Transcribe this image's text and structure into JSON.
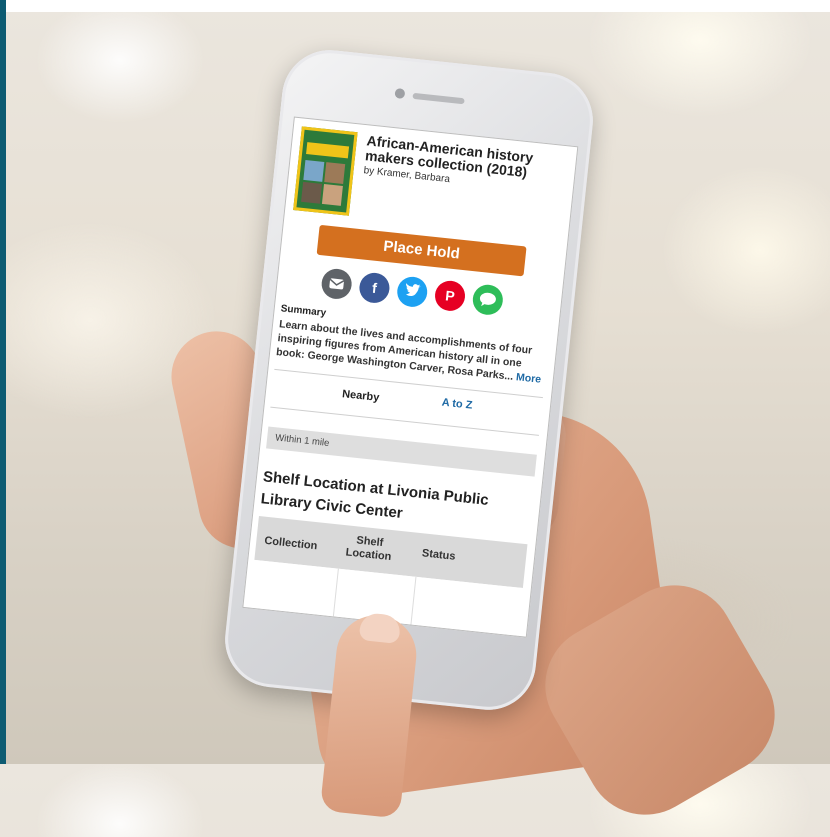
{
  "colors": {
    "accent_bar": "#0d5b72",
    "place_hold": "#d4701f",
    "link": "#1f6aa5"
  },
  "book": {
    "title": "African-American history makers collection (2018)",
    "author": "by Kramer, Barbara"
  },
  "actions": {
    "place_hold_label": "Place Hold"
  },
  "share": {
    "icons": [
      "email-icon",
      "facebook-icon",
      "twitter-icon",
      "pinterest-icon",
      "message-icon"
    ],
    "facebook_glyph": "f",
    "pinterest_glyph": "P"
  },
  "summary": {
    "label": "Summary",
    "text": "Learn about the lives and accomplishments of four inspiring figures from American history all in one book: George Washington Carver, Rosa Parks...",
    "more_label": "More"
  },
  "tabs": [
    {
      "label": "Nearby",
      "active": true
    },
    {
      "label": "A to Z",
      "active": false
    }
  ],
  "filter": {
    "within_label": "Within 1 mile"
  },
  "shelf": {
    "heading": "Shelf Location at Livonia Public Library Civic Center",
    "columns": [
      "Collection",
      "Shelf Location",
      "Status"
    ]
  }
}
